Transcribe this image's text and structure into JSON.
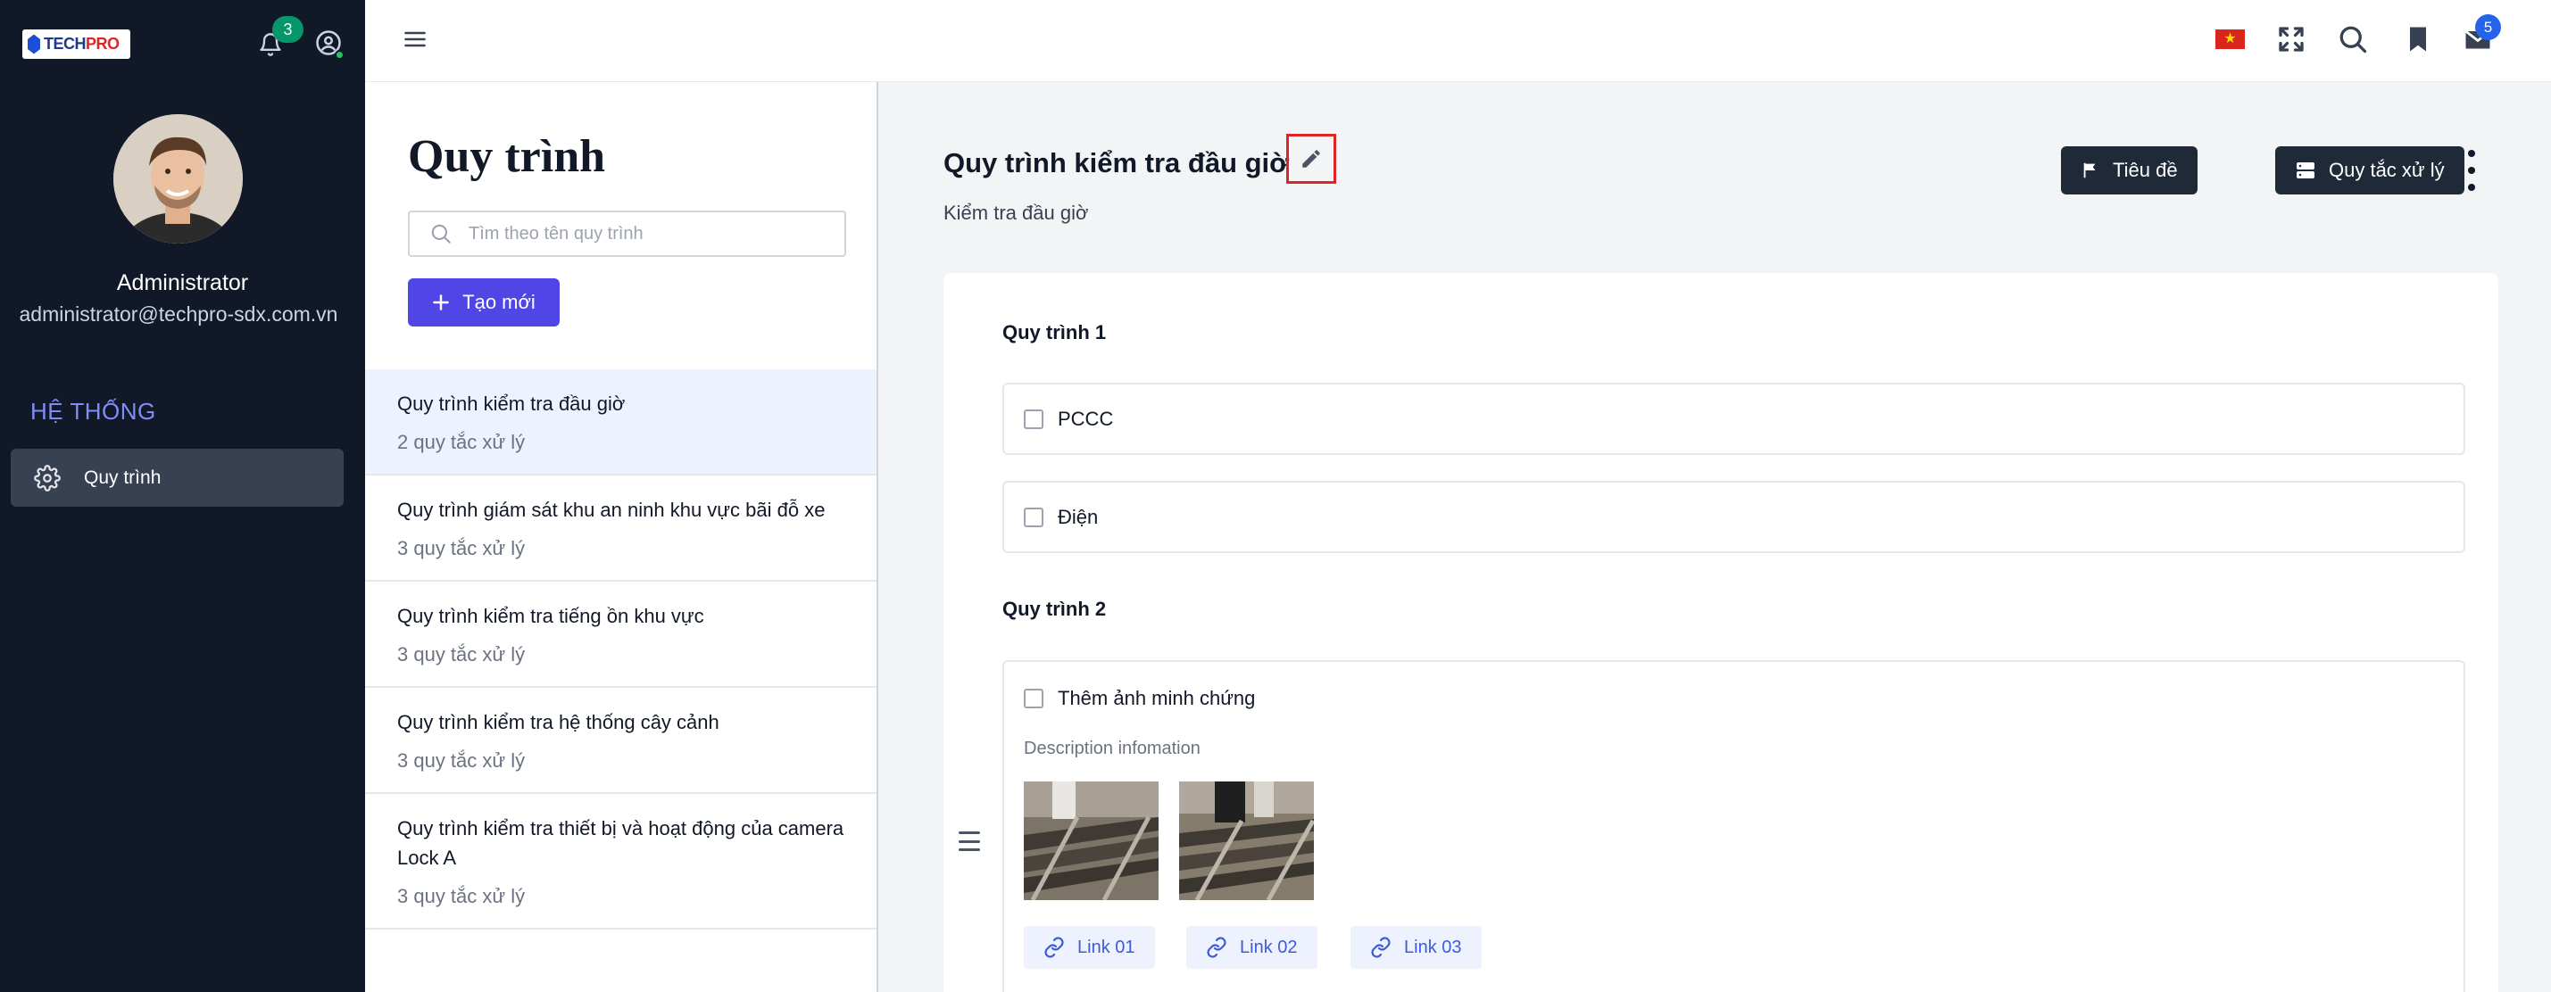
{
  "sidebar": {
    "logo_text_main": "TECH",
    "logo_text_accent": "PRO",
    "notification_count": "3",
    "user": {
      "name": "Administrator",
      "email": "administrator@techpro-sdx.com.vn"
    },
    "section_title": "HỆ THỐNG",
    "nav_items": [
      {
        "label": "Quy trình",
        "icon": "gear-icon"
      }
    ]
  },
  "topbar": {
    "icons": [
      "menu-icon",
      "vietnam-flag-icon",
      "fullscreen-icon",
      "search-icon",
      "bookmark-icon",
      "mail-icon"
    ],
    "mail_count": "5",
    "flag_star": "★"
  },
  "list_panel": {
    "title": "Quy trình",
    "search_placeholder": "Tìm theo tên quy trình",
    "create_label": "Tạo mới",
    "items": [
      {
        "title": "Quy trình kiểm tra đầu giờ",
        "subtitle": "2 quy tắc xử lý",
        "active": true
      },
      {
        "title": "Quy trình giám sát khu an ninh khu vực bãi đỗ xe",
        "subtitle": "3 quy tắc xử lý"
      },
      {
        "title": "Quy trình kiểm tra tiếng ồn khu vực",
        "subtitle": "3 quy tắc xử lý"
      },
      {
        "title": "Quy trình kiểm tra hệ thống cây cảnh",
        "subtitle": "3 quy tắc xử lý"
      },
      {
        "title": "Quy trình kiểm tra thiết bị và hoạt động của camera Lock A",
        "subtitle": "3 quy tắc xử lý"
      }
    ]
  },
  "detail": {
    "title": "Quy trình kiểm tra đầu giờ",
    "subtitle": "Kiểm tra đầu giờ",
    "buttons": {
      "header": "Tiêu đề",
      "rules": "Quy tắc xử lý"
    },
    "groups": [
      {
        "title": "Quy trình 1",
        "items": [
          "PCCC",
          "Điện"
        ]
      },
      {
        "title": "Quy trình 2",
        "item": {
          "label": "Thêm ảnh minh chứng",
          "description": "Description infomation",
          "images": [
            "evidence-photo-1",
            "evidence-photo-2"
          ],
          "links": [
            "Link 01",
            "Link 02",
            "Link 03"
          ]
        }
      }
    ]
  },
  "colors": {
    "sidebar_bg": "#111827",
    "accent": "#4f46e5",
    "section_title": "#818cf8",
    "notification_badge": "#059669",
    "mail_badge": "#2563eb",
    "edit_highlight": "#dc2626"
  }
}
